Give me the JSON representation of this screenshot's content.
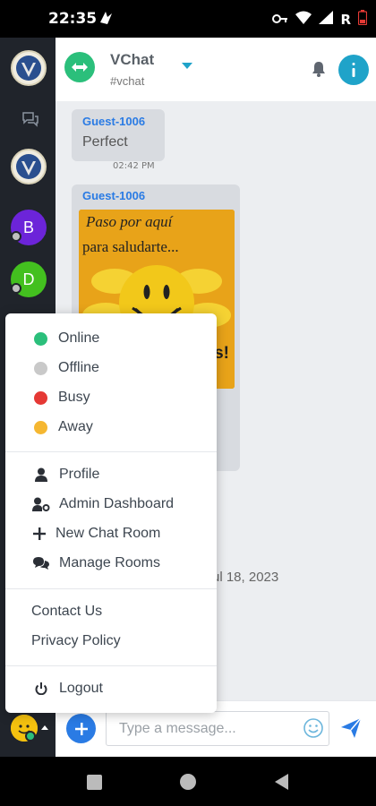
{
  "status_bar": {
    "time": "22:35",
    "network_label": "R"
  },
  "header": {
    "room_name": "VChat",
    "room_channel": "#vchat"
  },
  "messages": [
    {
      "sender": "Guest-1006",
      "text": "Perfect",
      "time": "02:42 PM"
    },
    {
      "sender": "Guest-1006",
      "image_caption_line1": "Paso por aquí",
      "image_caption_line2": "para saludarte...",
      "image_caption_line3": "s!"
    }
  ],
  "date_separator": "ul 18, 2023",
  "sidebar": {
    "rooms": [
      {
        "letter": "B",
        "color": "#6c24d9"
      },
      {
        "letter": "D",
        "color": "#43c01f"
      }
    ]
  },
  "composer": {
    "placeholder": "Type a message..."
  },
  "menu": {
    "statuses": [
      {
        "label": "Online",
        "color": "#2bbf7b"
      },
      {
        "label": "Offline",
        "color": "#c9c9c9"
      },
      {
        "label": "Busy",
        "color": "#e53935"
      },
      {
        "label": "Away",
        "color": "#f5b731"
      }
    ],
    "actions": [
      {
        "label": "Profile",
        "icon": "user-icon"
      },
      {
        "label": "Admin Dashboard",
        "icon": "user-cog-icon"
      },
      {
        "label": "New Chat Room",
        "icon": "plus-icon"
      },
      {
        "label": "Manage Rooms",
        "icon": "comments-icon"
      }
    ],
    "links": [
      {
        "label": "Contact Us"
      },
      {
        "label": "Privacy Policy"
      }
    ],
    "logout": {
      "label": "Logout",
      "icon": "power-icon"
    }
  }
}
